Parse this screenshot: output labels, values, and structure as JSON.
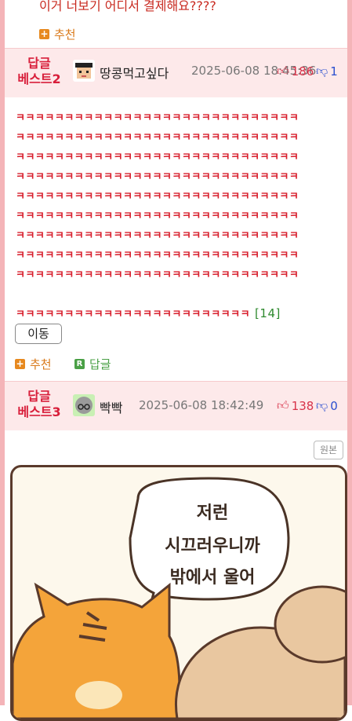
{
  "top_comment": {
    "text": "이거 너보기 어디서 결제해요????",
    "recommend_label": "추천"
  },
  "best2": {
    "tag_line1": "답글",
    "tag_line2": "베스트2",
    "nickname": "땅콩먹고싶다",
    "date": "2025-06-08 18:45:36",
    "upvotes": "186",
    "downvotes": "1",
    "lines": [
      "ㅋㅋㅋㅋㅋㅋㅋㅋㅋㅋㅋㅋㅋㅋㅋㅋㅋㅋㅋㅋㅋㅋㅋㅋㅋㅋㅋㅋㅋ",
      "ㅋㅋㅋㅋㅋㅋㅋㅋㅋㅋㅋㅋㅋㅋㅋㅋㅋㅋㅋㅋㅋㅋㅋㅋㅋㅋㅋㅋㅋ",
      "ㅋㅋㅋㅋㅋㅋㅋㅋㅋㅋㅋㅋㅋㅋㅋㅋㅋㅋㅋㅋㅋㅋㅋㅋㅋㅋㅋㅋㅋ",
      "ㅋㅋㅋㅋㅋㅋㅋㅋㅋㅋㅋㅋㅋㅋㅋㅋㅋㅋㅋㅋㅋㅋㅋㅋㅋㅋㅋㅋㅋ",
      "ㅋㅋㅋㅋㅋㅋㅋㅋㅋㅋㅋㅋㅋㅋㅋㅋㅋㅋㅋㅋㅋㅋㅋㅋㅋㅋㅋㅋㅋ",
      "ㅋㅋㅋㅋㅋㅋㅋㅋㅋㅋㅋㅋㅋㅋㅋㅋㅋㅋㅋㅋㅋㅋㅋㅋㅋㅋㅋㅋㅋ",
      "ㅋㅋㅋㅋㅋㅋㅋㅋㅋㅋㅋㅋㅋㅋㅋㅋㅋㅋㅋㅋㅋㅋㅋㅋㅋㅋㅋㅋㅋ",
      "ㅋㅋㅋㅋㅋㅋㅋㅋㅋㅋㅋㅋㅋㅋㅋㅋㅋㅋㅋㅋㅋㅋㅋㅋㅋㅋㅋㅋㅋ",
      "ㅋㅋㅋㅋㅋㅋㅋㅋㅋㅋㅋㅋㅋㅋㅋㅋㅋㅋㅋㅋㅋㅋㅋㅋㅋㅋㅋㅋㅋ",
      "ㅋㅋㅋㅋㅋㅋㅋㅋㅋㅋㅋㅋㅋㅋㅋㅋㅋㅋㅋㅋㅋㅋㅋㅋ"
    ],
    "reply_count": "[14]",
    "move_label": "이동",
    "recommend_label": "추천",
    "reply_label": "답글"
  },
  "best3": {
    "tag_line1": "답글",
    "tag_line2": "베스트3",
    "nickname": "빡빡",
    "date": "2025-06-08 18:42:49",
    "upvotes": "138",
    "downvotes": "0",
    "original_label": "원본",
    "comic_bubble": [
      "저런",
      "시끄러우니까",
      "밖에서 울어"
    ]
  },
  "colors": {
    "accent_red": "#d81e3a",
    "recommend_orange": "#e7891f",
    "reply_green": "#4aa046",
    "header_bg": "#fde9ea",
    "frame_pink": "#f4b4b8"
  }
}
